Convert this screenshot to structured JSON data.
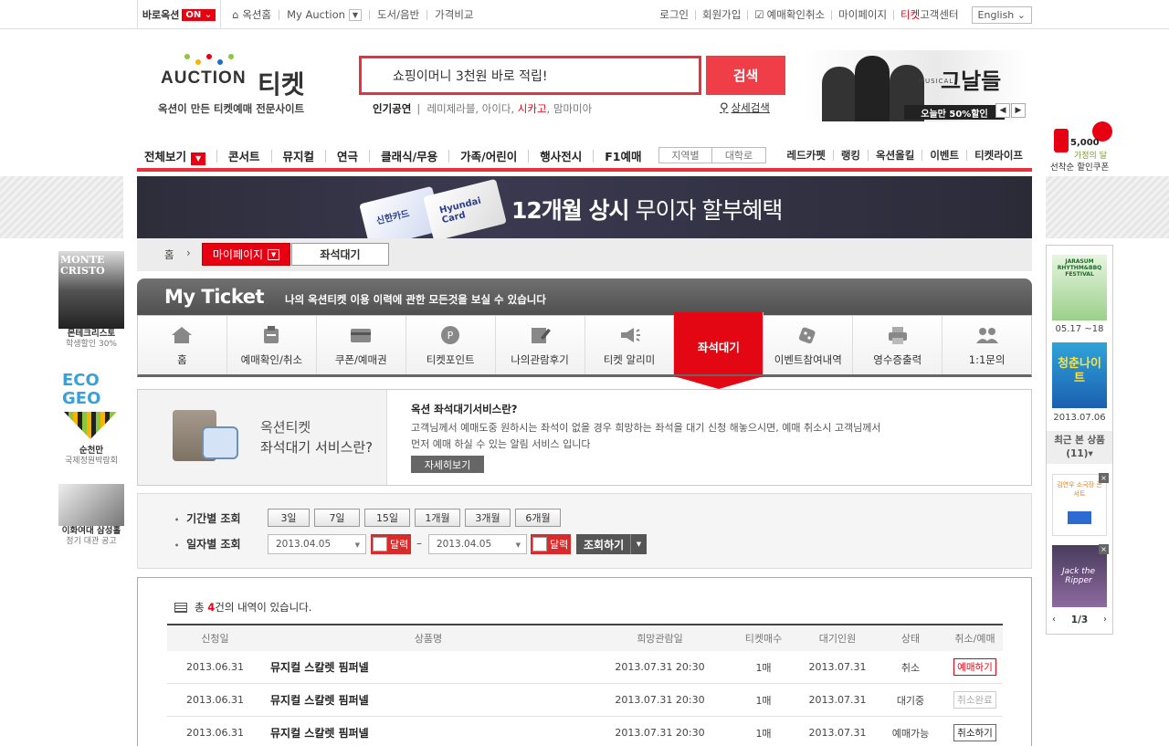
{
  "topbar": {
    "shortcut": "바로옥션",
    "on_badge": "ON",
    "links": [
      "옥션홈",
      "My Auction",
      "도서/음반",
      "가격비교"
    ],
    "right_links": [
      "로그인",
      "회원가입",
      "예매확인취소",
      "마이페이지"
    ],
    "center_prefix": "티켓",
    "center": "고객센터",
    "lang": "English"
  },
  "logo": {
    "word": "AUCTION",
    "kor": "티켓",
    "sub": "옥션이 만든 티켓예매 전문사이트"
  },
  "search": {
    "value": "쇼핑이머니 3천원 바로 적립!",
    "button": "검색",
    "detail": "상세검색"
  },
  "popular": {
    "label": "인기공연",
    "items": [
      "레미제라블",
      "아이다",
      "시카고",
      "맘마미아"
    ]
  },
  "banner1": {
    "title": "그날들",
    "musical": "MUSICAL",
    "sale": "오늘만 50%할인"
  },
  "nav": {
    "all": "전체보기",
    "items": [
      "콘서트",
      "뮤지컬",
      "연극",
      "클래식/무용",
      "가족/어린이",
      "행사전시",
      "F1예매"
    ],
    "mid": [
      "지역별",
      "대학로"
    ],
    "right": [
      "레드카펫",
      "랭킹",
      "옥션올킬",
      "이벤트",
      "티켓라이프"
    ]
  },
  "banner2": {
    "card1": "신한카드",
    "card2": "Hyundai Card",
    "bold": "12개월 상시",
    "rest": " 무이자 할부혜택"
  },
  "breadcrumb": {
    "home": "홈",
    "current": "마이페이지",
    "sub": "좌석대기"
  },
  "myticket": {
    "title": "My Ticket",
    "desc": "나의 옥션티켓 이용 이력에 관한 모든것을 보실 수 있습니다",
    "tabs": [
      "홈",
      "예매확인/취소",
      "쿠폰/예매권",
      "티켓포인트",
      "나의관람후기",
      "티켓 알리미",
      "좌석대기",
      "이벤트참여내역",
      "영수증출력",
      "1:1문의"
    ]
  },
  "info": {
    "img_line1": "옥션티켓",
    "img_line2": "좌석대기 서비스란?",
    "heading": "옥션 좌석대기서비스란?",
    "line1": "고객님께서 예매도중 원하시는 좌석이 없을 경우 희망하는 좌석을 대기 신청 해놓으시면, 예매 취소시 고객님께서",
    "line2": "먼저 예매 하실 수 있는 알림 서비스 입니다",
    "button": "자세히보기"
  },
  "period": {
    "label1": "기간별 조회",
    "label2": "일자별 조회",
    "buttons": [
      "3일",
      "7일",
      "15일",
      "1개월",
      "3개월",
      "6개월"
    ],
    "from": "2013.04.05",
    "to": "2013.04.05",
    "cal": "달력",
    "dash": "–",
    "query": "조회하기"
  },
  "results": {
    "prefix": "총 ",
    "count": "4",
    "suffix": "건의 내역이 있습니다.",
    "headers": [
      "신청일",
      "상품명",
      "희망관람일",
      "티켓매수",
      "대기인원",
      "상태",
      "취소/예매"
    ],
    "rows": [
      {
        "date": "2013.06.31",
        "name": "뮤지컬 스칼렛 핌퍼넬",
        "wish": "2013.07.31  20:30",
        "qty": "1매",
        "wait": "2013.07.31",
        "status": "취소",
        "action": "예매하기"
      },
      {
        "date": "2013.06.31",
        "name": "뮤지컬 스칼렛 핌퍼넬",
        "wish": "2013.07.31  20:30",
        "qty": "1매",
        "wait": "2013.07.31",
        "status": "대기중",
        "action": "취소완료"
      },
      {
        "date": "2013.06.31",
        "name": "뮤지컬 스칼렛 핌퍼넬",
        "wish": "2013.07.31  20:30",
        "qty": "1매",
        "wait": "2013.07.31",
        "status": "예매가능",
        "action": "취소하기"
      }
    ]
  },
  "left_ads": [
    {
      "title": "MONTE CRISTO",
      "cap": "몬테크리스토",
      "cap2": "학생할인 30%"
    },
    {
      "title": "ECO GEO",
      "cap": "순천만",
      "cap2": "국제정원박람회"
    },
    {
      "title": "",
      "cap": "이화여대 삼성홀",
      "cap2": "정기 대관 공고"
    }
  ],
  "right": {
    "badge_amount": "5,000",
    "badge_text": "가정의 달",
    "badge_sub": "선착순 할인쿠폰",
    "ad1_date": "05.17 ~18",
    "ad1_title": "JARASUM RHYTHM&BBQ FESTIVAL",
    "ad2_title": "청춘나이트",
    "ad2_date": "2013.07.06",
    "recent": "최근 본 상품",
    "recent_count": "(11)",
    "thumb1": "김연우 소극장 콘서트",
    "thumb2": "Jack the Ripper",
    "page": "1/3"
  },
  "colors": {
    "accent": "#e8313c",
    "red": "#e60012"
  }
}
